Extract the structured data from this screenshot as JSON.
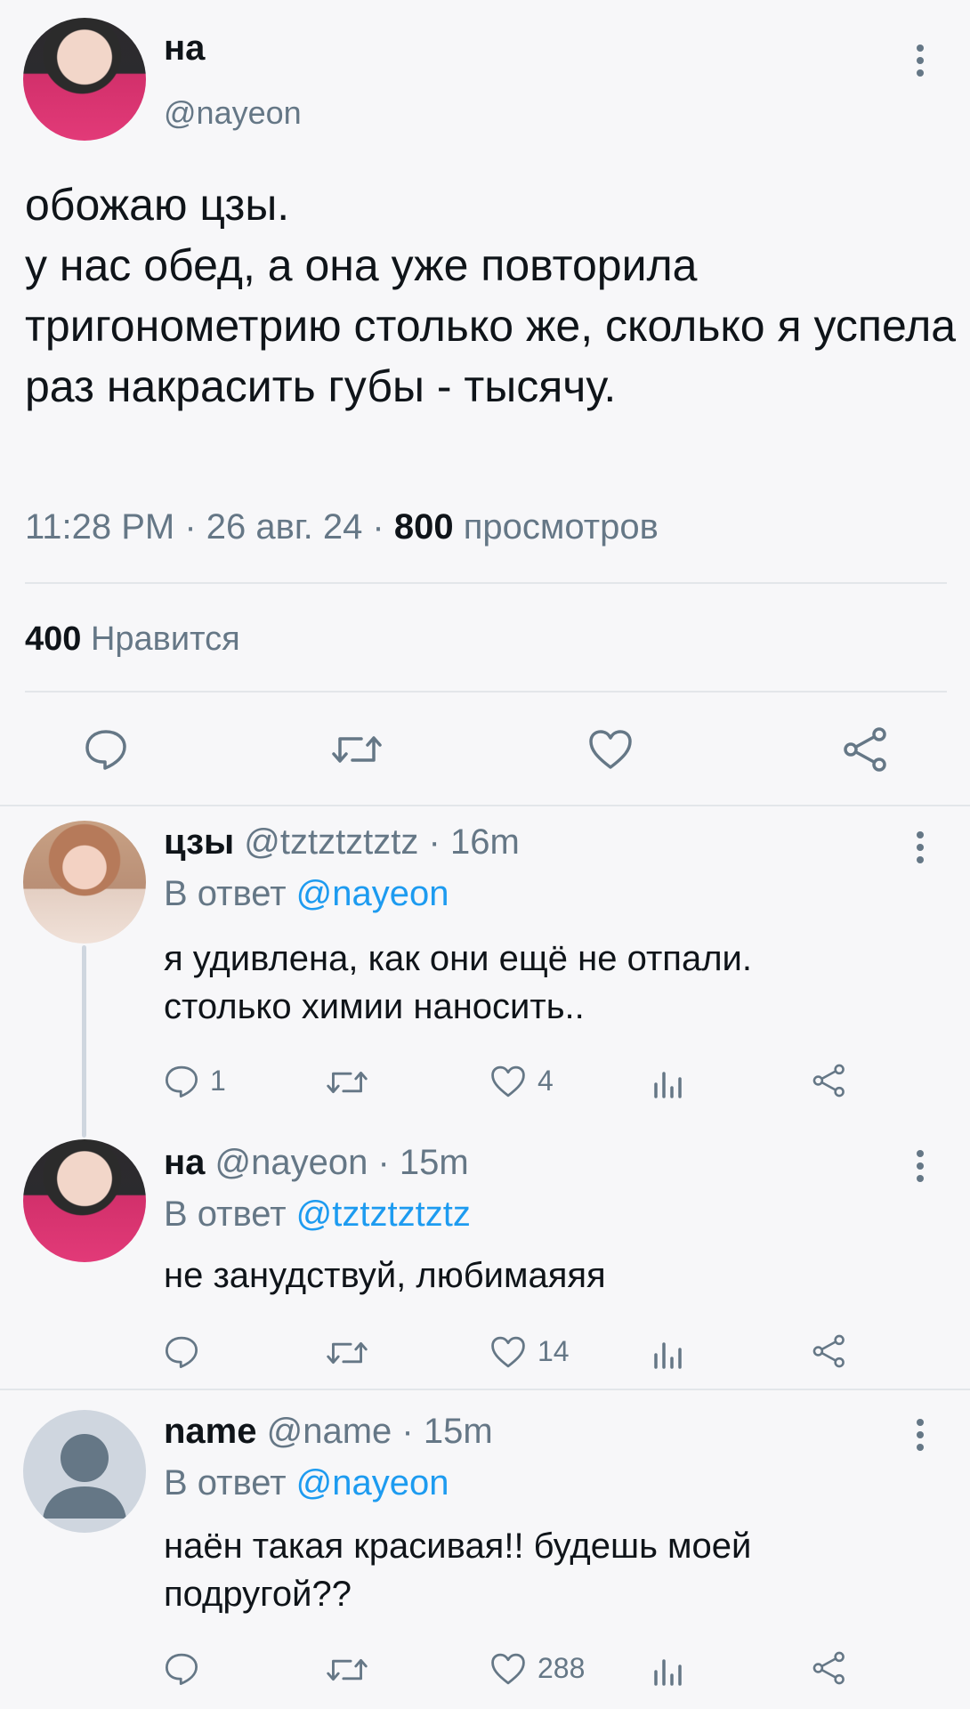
{
  "main_tweet": {
    "name": "на",
    "handle": "@nayeon",
    "text": "обожаю цзы.\nу нас обед, а она уже повторила тригонометрию столько же, сколько я успела раз накрасить губы - тысячу.",
    "time": "11:28 PM · 26 авг. 24 · ",
    "views_count": "800",
    "views_label": " просмотров",
    "likes_count": "400",
    "likes_label": " Нравится"
  },
  "replies": [
    {
      "name": "цзы",
      "handle_time": " @tztztztztz · 16m",
      "in_reply_prefix": "В ответ ",
      "in_reply_mention": "@nayeon",
      "text": "я удивлена, как они ещё не отпали.\nстолько химии наносить..",
      "reply_count": "1",
      "like_count": "4"
    },
    {
      "name": "на",
      "handle_time": " @nayeon · 15m",
      "in_reply_prefix": "В ответ ",
      "in_reply_mention": "@tztztztztz",
      "text": "не занудствуй, любимаяяя",
      "reply_count": "",
      "like_count": "14"
    },
    {
      "name": "name",
      "handle_time": " @name · 15m",
      "in_reply_prefix": "В ответ ",
      "in_reply_mention": "@nayeon",
      "text": "наён такая красивая!! будешь моей\nподругой??",
      "reply_count": "",
      "like_count": "288"
    }
  ],
  "colors": {
    "background": "#f7f7f9",
    "secondary_text": "#657786",
    "mention": "#1d9bf0",
    "divider": "#e3e6ea"
  },
  "icons": [
    "more-icon",
    "reply-icon",
    "retweet-icon",
    "like-icon",
    "share-icon",
    "views-icon",
    "default-avatar-icon"
  ]
}
